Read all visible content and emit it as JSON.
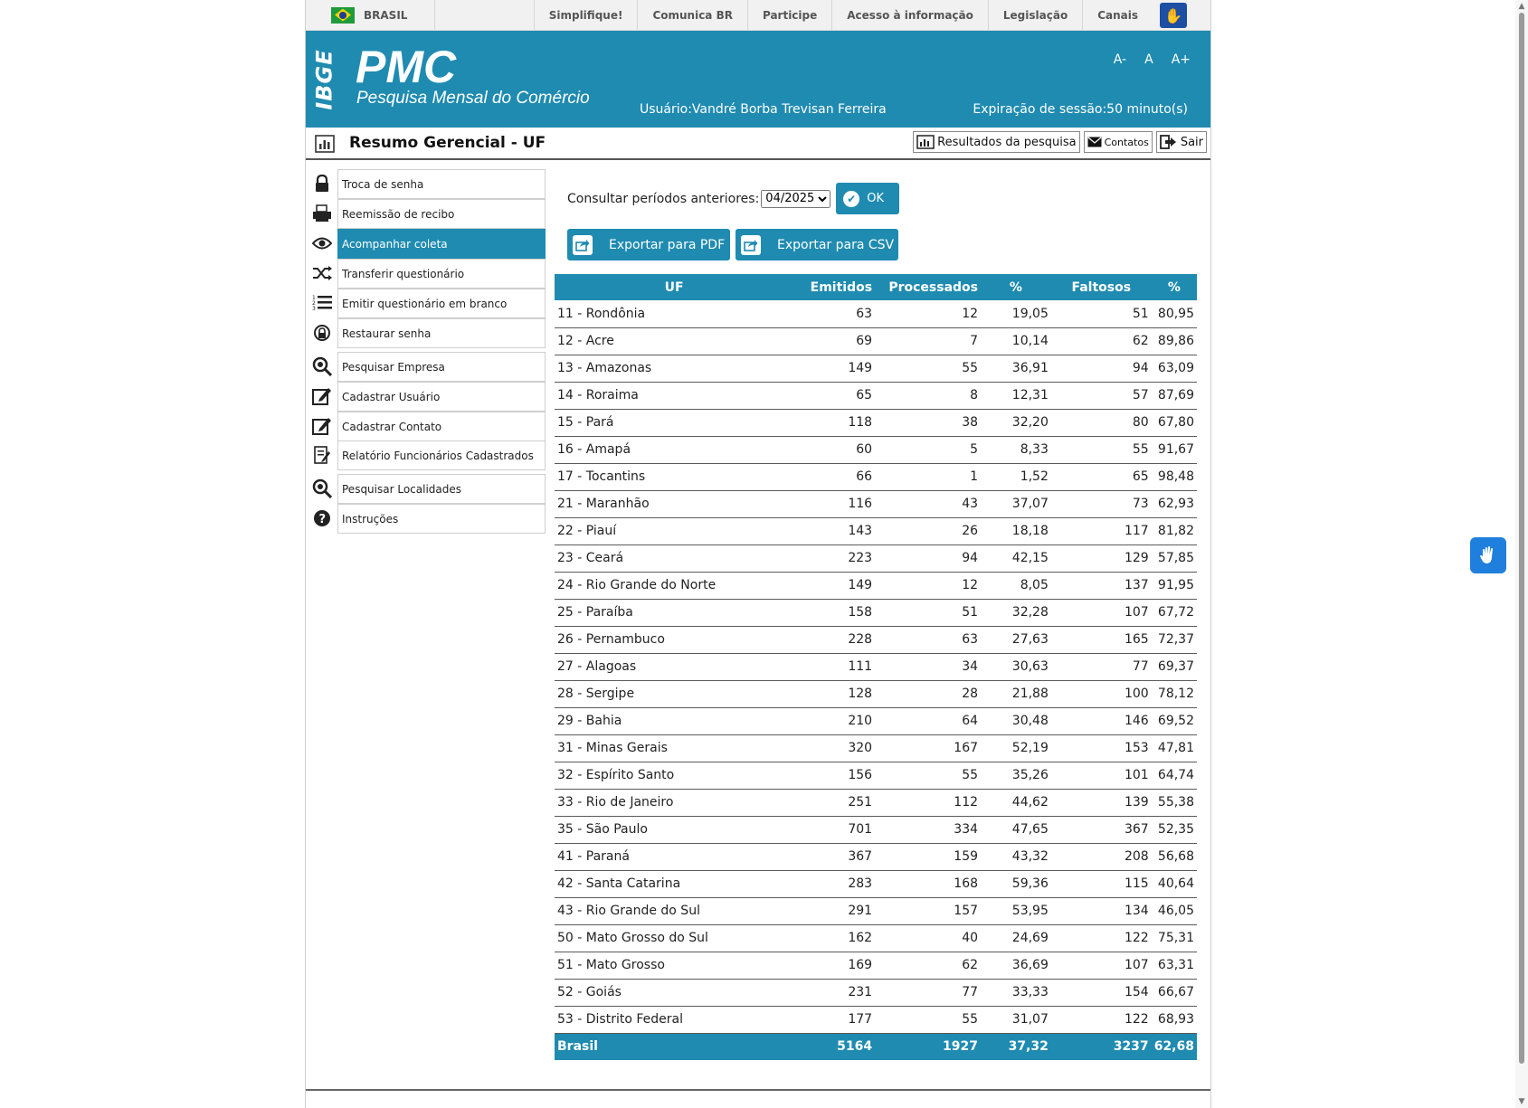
{
  "govbar": {
    "country": "BRASIL",
    "links": [
      "Simplifique!",
      "Comunica BR",
      "Participe",
      "Acesso à informação",
      "Legislação",
      "Canais"
    ]
  },
  "header": {
    "logo_text": "IBGE",
    "app_title": "PMC",
    "app_subtitle": "Pesquisa Mensal do Comércio",
    "font_controls": [
      "A-",
      "A",
      "A+"
    ],
    "user": "Usuário:Vandré Borba Trevisan Ferreira",
    "session": "Expiração de sessão:50 minuto(s)"
  },
  "titlebar": {
    "title": "Resumo Gerencial - UF",
    "buttons": {
      "results": "Resultados da pesquisa",
      "contacts": "Contatos",
      "exit": "Sair"
    }
  },
  "sidebar": {
    "items": [
      {
        "label": "Troca de senha",
        "icon": "lock-icon"
      },
      {
        "label": "Reemissão de recibo",
        "icon": "printer-icon"
      },
      {
        "label": "Acompanhar coleta",
        "icon": "eye-icon",
        "active": true
      },
      {
        "label": "Transferir questionário",
        "icon": "shuffle-icon"
      },
      {
        "label": "Emitir questionário em branco",
        "icon": "numbered-list-icon"
      },
      {
        "label": "Restaurar senha",
        "icon": "key-reset-icon"
      },
      {
        "label": "Pesquisar Empresa",
        "icon": "search-icon"
      },
      {
        "label": "Cadastrar Usuário",
        "icon": "edit-icon"
      },
      {
        "label": "Cadastrar Contato",
        "icon": "edit-icon"
      },
      {
        "label": "Relatório Funcionários Cadastrados",
        "icon": "report-icon"
      },
      {
        "label": "Pesquisar Localidades",
        "icon": "search-icon"
      },
      {
        "label": "Instruções",
        "icon": "help-icon"
      }
    ]
  },
  "consult": {
    "label": "Consultar períodos anteriores:",
    "selected_period": "04/2025",
    "ok_label": "OK"
  },
  "export": {
    "pdf": "Exportar para PDF",
    "csv": "Exportar para CSV"
  },
  "table": {
    "headers": [
      "UF",
      "Emitidos",
      "Processados",
      "%",
      "Faltosos",
      "%"
    ],
    "rows": [
      [
        "11 - Rondônia",
        "63",
        "12",
        "19,05",
        "51",
        "80,95"
      ],
      [
        "12 - Acre",
        "69",
        "7",
        "10,14",
        "62",
        "89,86"
      ],
      [
        "13 - Amazonas",
        "149",
        "55",
        "36,91",
        "94",
        "63,09"
      ],
      [
        "14 - Roraima",
        "65",
        "8",
        "12,31",
        "57",
        "87,69"
      ],
      [
        "15 - Pará",
        "118",
        "38",
        "32,20",
        "80",
        "67,80"
      ],
      [
        "16 - Amapá",
        "60",
        "5",
        "8,33",
        "55",
        "91,67"
      ],
      [
        "17 - Tocantins",
        "66",
        "1",
        "1,52",
        "65",
        "98,48"
      ],
      [
        "21 - Maranhão",
        "116",
        "43",
        "37,07",
        "73",
        "62,93"
      ],
      [
        "22 - Piauí",
        "143",
        "26",
        "18,18",
        "117",
        "81,82"
      ],
      [
        "23 - Ceará",
        "223",
        "94",
        "42,15",
        "129",
        "57,85"
      ],
      [
        "24 - Rio Grande do Norte",
        "149",
        "12",
        "8,05",
        "137",
        "91,95"
      ],
      [
        "25 - Paraíba",
        "158",
        "51",
        "32,28",
        "107",
        "67,72"
      ],
      [
        "26 - Pernambuco",
        "228",
        "63",
        "27,63",
        "165",
        "72,37"
      ],
      [
        "27 - Alagoas",
        "111",
        "34",
        "30,63",
        "77",
        "69,37"
      ],
      [
        "28 - Sergipe",
        "128",
        "28",
        "21,88",
        "100",
        "78,12"
      ],
      [
        "29 - Bahia",
        "210",
        "64",
        "30,48",
        "146",
        "69,52"
      ],
      [
        "31 - Minas Gerais",
        "320",
        "167",
        "52,19",
        "153",
        "47,81"
      ],
      [
        "32 - Espírito Santo",
        "156",
        "55",
        "35,26",
        "101",
        "64,74"
      ],
      [
        "33 - Rio de Janeiro",
        "251",
        "112",
        "44,62",
        "139",
        "55,38"
      ],
      [
        "35 - São Paulo",
        "701",
        "334",
        "47,65",
        "367",
        "52,35"
      ],
      [
        "41 - Paraná",
        "367",
        "159",
        "43,32",
        "208",
        "56,68"
      ],
      [
        "42 - Santa Catarina",
        "283",
        "168",
        "59,36",
        "115",
        "40,64"
      ],
      [
        "43 - Rio Grande do Sul",
        "291",
        "157",
        "53,95",
        "134",
        "46,05"
      ],
      [
        "50 - Mato Grosso do Sul",
        "162",
        "40",
        "24,69",
        "122",
        "75,31"
      ],
      [
        "51 - Mato Grosso",
        "169",
        "62",
        "36,69",
        "107",
        "63,31"
      ],
      [
        "52 - Goiás",
        "231",
        "77",
        "33,33",
        "154",
        "66,67"
      ],
      [
        "53 - Distrito Federal",
        "177",
        "55",
        "31,07",
        "122",
        "68,93"
      ]
    ],
    "total": [
      "Brasil",
      "5164",
      "1927",
      "37,32",
      "3237",
      "62,68"
    ]
  },
  "colors": {
    "accent": "#1f8bb1",
    "libras": "#1f7fdc"
  }
}
